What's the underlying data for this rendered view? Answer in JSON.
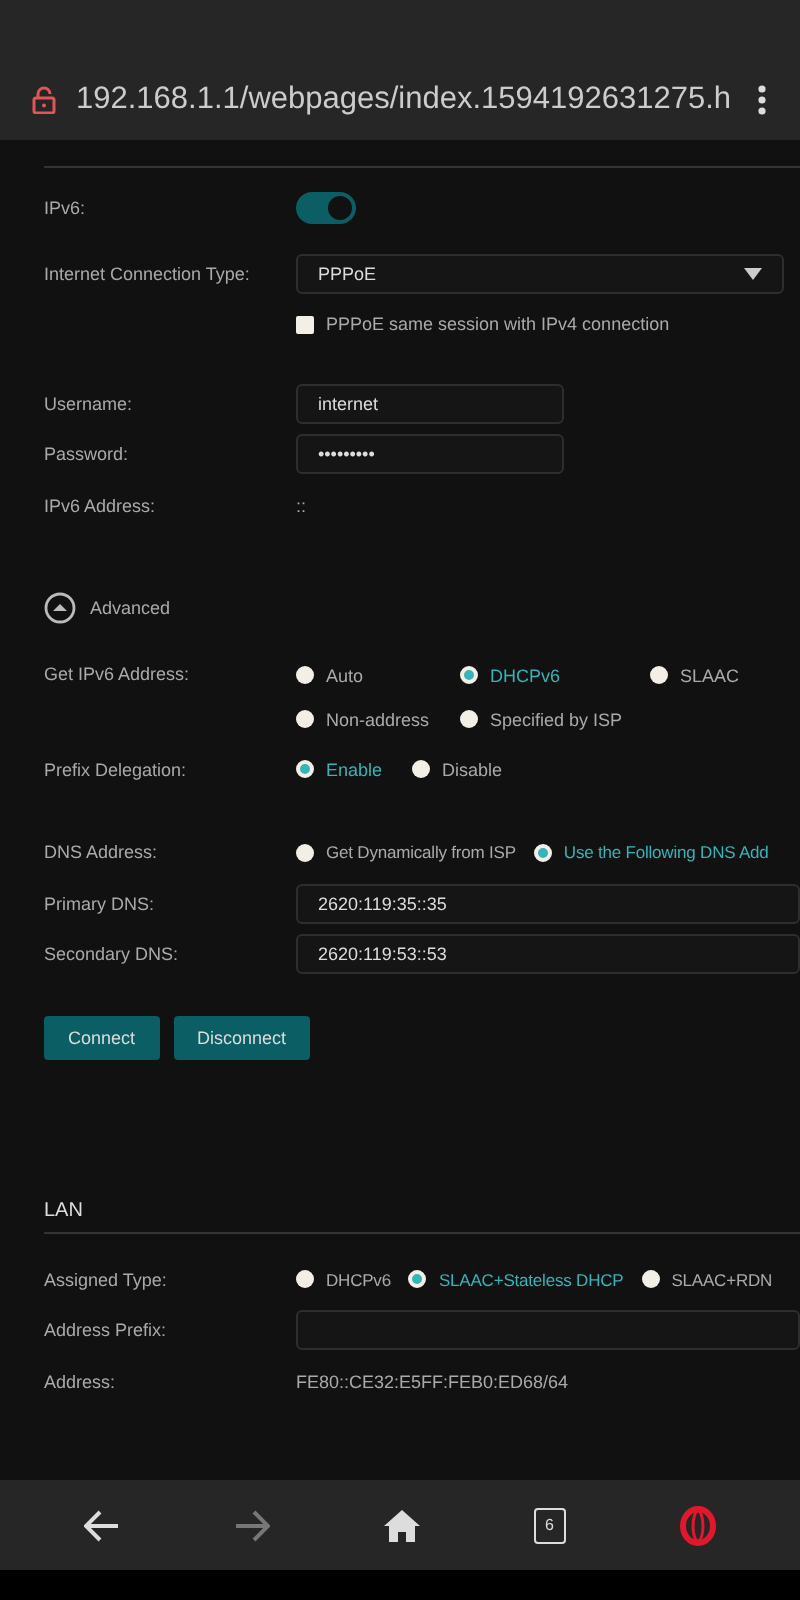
{
  "address_bar": {
    "url": "192.168.1.1/webpages/index.1594192631275.h"
  },
  "ipv6": {
    "label": "IPv6:",
    "on": true
  },
  "connection_type": {
    "label": "Internet Connection Type:",
    "value": "PPPoE"
  },
  "same_session": {
    "label": "PPPoE same session with IPv4 connection",
    "checked": false
  },
  "username": {
    "label": "Username:",
    "value": "internet"
  },
  "password": {
    "label": "Password:",
    "value": "•••••••••"
  },
  "ipv6_address": {
    "label": "IPv6 Address:",
    "value": "::"
  },
  "advanced": {
    "label": "Advanced",
    "expanded": true
  },
  "get_ipv6_address": {
    "label": "Get IPv6 Address:",
    "options": [
      {
        "label": "Auto",
        "selected": false
      },
      {
        "label": "DHCPv6",
        "selected": true
      },
      {
        "label": "SLAAC",
        "selected": false
      },
      {
        "label": "Non-address",
        "selected": false
      },
      {
        "label": "Specified by ISP",
        "selected": false
      }
    ]
  },
  "prefix_delegation": {
    "label": "Prefix Delegation:",
    "options": [
      {
        "label": "Enable",
        "selected": true
      },
      {
        "label": "Disable",
        "selected": false
      }
    ]
  },
  "dns_address": {
    "label": "DNS Address:",
    "options": [
      {
        "label": "Get Dynamically from ISP",
        "selected": false
      },
      {
        "label": "Use the Following DNS Add",
        "selected": true
      }
    ]
  },
  "primary_dns": {
    "label": "Primary DNS:",
    "value": "2620:119:35::35"
  },
  "secondary_dns": {
    "label": "Secondary DNS:",
    "value": "2620:119:53::53"
  },
  "buttons": [
    "Connect",
    "Disconnect"
  ],
  "lan": {
    "title": "LAN",
    "assigned_type": {
      "label": "Assigned Type:",
      "options": [
        {
          "label": "DHCPv6",
          "selected": false
        },
        {
          "label": "SLAAC+Stateless DHCP",
          "selected": true
        },
        {
          "label": "SLAAC+RDN",
          "selected": false
        }
      ]
    },
    "address_prefix": {
      "label": "Address Prefix:"
    },
    "address": {
      "label": "Address:",
      "value": "FE80::CE32:E5FF:FEB0:ED68/64"
    }
  },
  "bottom_bar": {
    "tab_count": "6"
  }
}
